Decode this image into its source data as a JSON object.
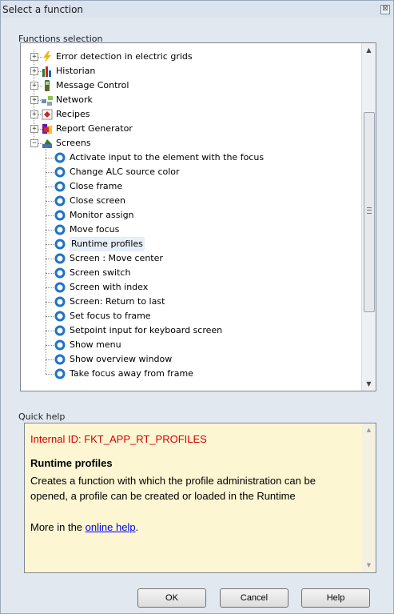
{
  "window": {
    "title": "Select a function",
    "close_glyph": "⊠"
  },
  "functions_selection": {
    "group_label": "Functions selection",
    "tree": [
      {
        "label": "Error detection in electric grids",
        "expander": "+",
        "icon": "lightning-icon",
        "color": "#f5b800"
      },
      {
        "label": "Historian",
        "expander": "+",
        "icon": "historian-bars-icon",
        "color": "#2f7d32"
      },
      {
        "label": "Message Control",
        "expander": "+",
        "icon": "message-device-icon",
        "color": "#556b2f"
      },
      {
        "label": "Network",
        "expander": "+",
        "icon": "network-icon",
        "color": "#6b8fb5"
      },
      {
        "label": "Recipes",
        "expander": "+",
        "icon": "recipe-icon",
        "color": "#c62828"
      },
      {
        "label": "Report Generator",
        "expander": "+",
        "icon": "report-generator-icon",
        "color": "#6a1b9a"
      },
      {
        "label": "Screens",
        "expander": "−",
        "icon": "screens-icon",
        "color": "#2e7d32"
      }
    ],
    "screen_items": [
      "Activate input to the element with the focus",
      "Change ALC source color",
      "Close frame",
      "Close screen",
      "Monitor assign",
      "Move focus",
      "Runtime profiles",
      "Screen : Move center",
      "Screen switch",
      "Screen with index",
      "Screen: Return to last",
      "Set focus to frame",
      "Setpoint input for keyboard screen",
      "Show menu",
      "Show overview window",
      "Take focus away from frame"
    ],
    "selected_item": "Runtime profiles",
    "function_icon": "blue-function-circle-icon",
    "function_icon_color": "#1e73c8"
  },
  "quick_help": {
    "group_label": "Quick help",
    "internal_id": "Internal ID: FKT_APP_RT_PROFILES",
    "title": "Runtime profiles",
    "description": "Creates a function with which the profile administration can be opened, a profile can be created or loaded in the Runtime",
    "more_prefix": "More in the ",
    "link_text": "online help",
    "more_suffix": ".",
    "id_color": "#d40000",
    "background_color": "#fdf6d3"
  },
  "buttons": {
    "ok": "OK",
    "cancel": "Cancel",
    "help": "Help"
  }
}
